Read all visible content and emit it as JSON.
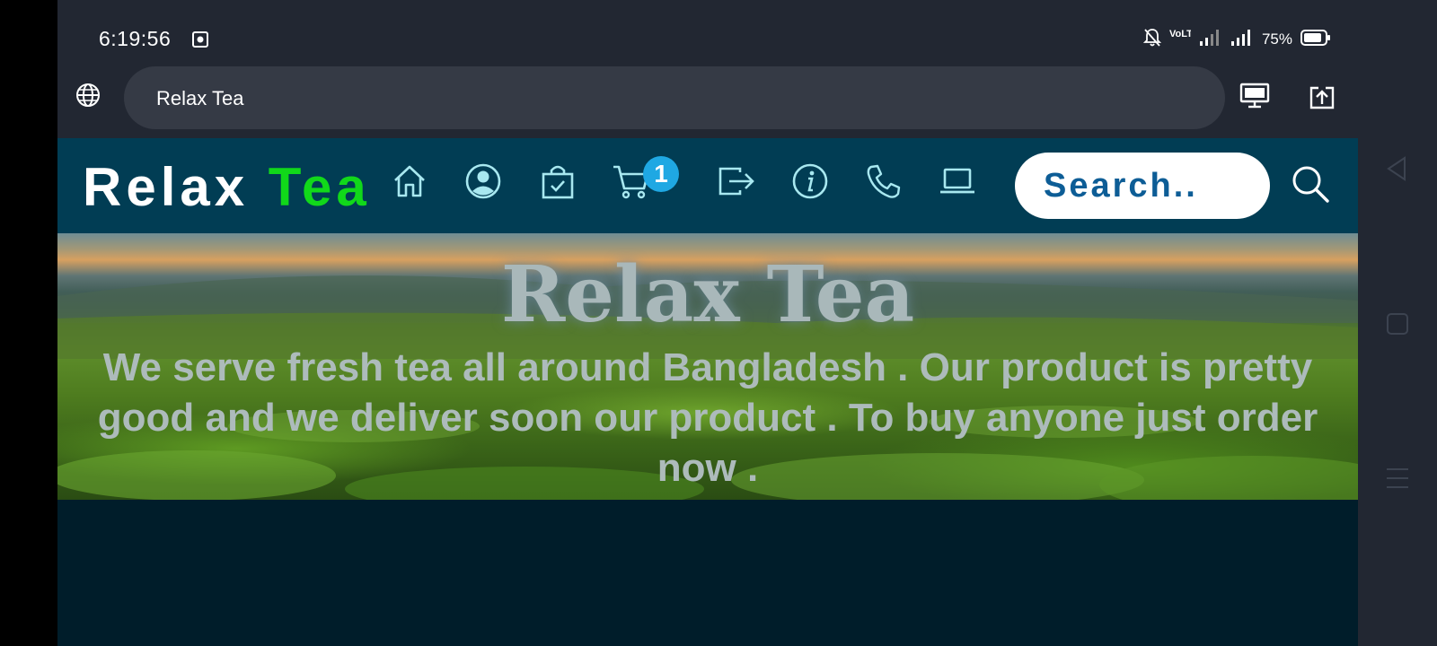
{
  "status_bar": {
    "time": "6:19:56",
    "network_label": "VoLTE",
    "battery": "75%"
  },
  "address_bar": {
    "url_text": "Relax Tea"
  },
  "site": {
    "brand_part1": "Relax ",
    "brand_part2": "Tea",
    "brand_accent_color": "#11d81a",
    "cart_count": "1",
    "search_placeholder": "Search..",
    "nav_icons": [
      "home-icon",
      "user-icon",
      "shopping-bag-icon",
      "cart-icon",
      "logout-icon",
      "info-icon",
      "phone-icon",
      "laptop-icon",
      "search-icon"
    ]
  },
  "hero": {
    "title": "Relax Tea",
    "text": "We serve fresh tea all around Bangladesh . Our product is pretty good and we deliver soon our product . To buy anyone just order now ."
  },
  "colors": {
    "navbar": "#013d54",
    "page_bg": "#001d2a",
    "icon": "#a8e8f0",
    "badge": "#1fa8e3"
  }
}
